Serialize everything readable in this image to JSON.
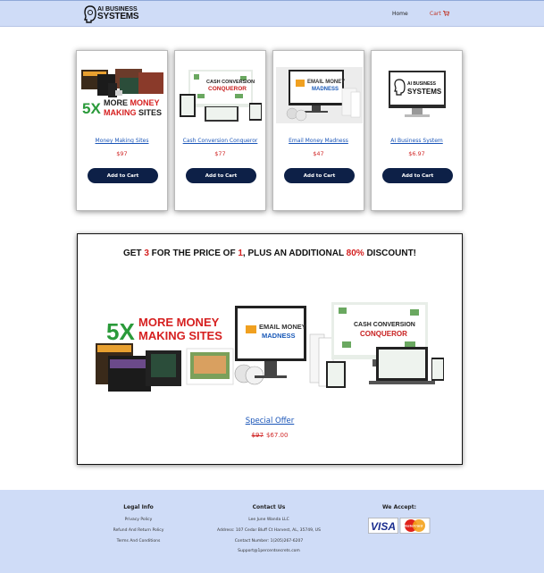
{
  "header": {
    "logo_line1": "AI BUSINESS",
    "logo_line2": "SYSTEMS",
    "nav_home": "Home",
    "nav_cart": "Cart"
  },
  "products": [
    {
      "title": "Money Making Sites",
      "price": "$97",
      "button": "Add to Cart",
      "art": "5X MORE MONEY MAKING SITES"
    },
    {
      "title": "Cash Conversion Conqueror",
      "price": "$77",
      "button": "Add to Cart",
      "art": "CASH CONVERSION CONQUEROR"
    },
    {
      "title": "Email Money Madness",
      "price": "$47",
      "button": "Add to Cart",
      "art": "EMAIL MONEY MADNESS"
    },
    {
      "title": "AI Business System",
      "price": "$6.97",
      "button": "Add to Cart",
      "art": "AI BUSINESS SYSTEMS"
    }
  ],
  "offer": {
    "heading_part1": "GET ",
    "heading_num1": "3",
    "heading_part2": " FOR THE PRICE OF ",
    "heading_num2": "1",
    "heading_part3": ", PLUS AN ADDITIONAL ",
    "heading_num3": "80%",
    "heading_part4": " DISCOUNT!",
    "link": "Special Offer",
    "old_price": "$97",
    "new_price": "$67.00",
    "art_5x": "5X",
    "art_more_money": "MORE MONEY",
    "art_making_sites": "MAKING SITES",
    "art_email_money": "EMAIL MONEY",
    "art_madness": "MADNESS",
    "art_cash_conversion": "CASH CONVERSION",
    "art_conqueror": "CONQUEROR"
  },
  "footer": {
    "legal_heading": "Legal Info",
    "legal_links": [
      "Privacy Policy",
      "Refund And Return Policy",
      "Terms And Conditions"
    ],
    "contact_heading": "Contact Us",
    "contact_lines": [
      "Lee June Wanda LLC",
      "Address: 107 Cedar Bluff Ct Harvest, AL, 35749, US",
      "Contact Number: 1(205)267-6207",
      "Support@1percentsecrets.com"
    ],
    "accept_heading": "We Accept:",
    "visa": "VISA",
    "mastercard": "MasterCard"
  },
  "colors": {
    "header_bg": "#cfdcf7",
    "button_bg": "#0d2047",
    "price_red": "#d12b2b",
    "link_blue": "#1a55b8",
    "accent_red": "#d41f1f"
  }
}
